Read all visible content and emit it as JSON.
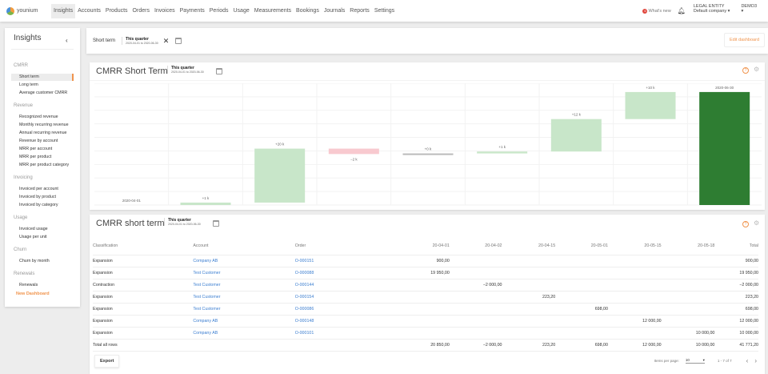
{
  "nav": {
    "logo": "younium",
    "items": [
      "Insights",
      "Accounts",
      "Products",
      "Orders",
      "Invoices",
      "Payments",
      "Periods",
      "Usage",
      "Measurements",
      "Bookings",
      "Journals",
      "Reports",
      "Settings"
    ],
    "active": "Insights",
    "whats_new_count": "6",
    "whats_new": "What's new",
    "legal_entity_label": "LEGAL ENTITY",
    "legal_entity": "Default company",
    "user": "DEMO3"
  },
  "sidebar": {
    "title": "Insights",
    "groups": [
      {
        "label": "CMRR",
        "items": [
          "Short term",
          "Long term",
          "Average customer CMRR"
        ]
      },
      {
        "label": "Revenue",
        "items": [
          "Recognized revenue",
          "Monthly recurring revenue",
          "Annual recurring revenue",
          "Revenue by account",
          "MRR per account",
          "MRR per product",
          "MRR per product category"
        ]
      },
      {
        "label": "Invoicing",
        "items": [
          "Invoiced per account",
          "Invoiced by product",
          "Invoiced by category"
        ]
      },
      {
        "label": "Usage",
        "items": [
          "Invoiced usage",
          "Usage per unit"
        ]
      },
      {
        "label": "Churn",
        "items": [
          "Churn by month"
        ]
      },
      {
        "label": "Renewals",
        "items": [
          "Renewals"
        ]
      }
    ],
    "active": "Short term",
    "new_dashboard": "New Dashboard"
  },
  "filter": {
    "label": "Short term",
    "period": "This quarter",
    "range": "2020-04-01 to 2020-06-30",
    "edit": "Edit dashboard"
  },
  "chart_card": {
    "title": "CMRR Short Term",
    "period": "This quarter",
    "range": "2020-04-01 to 2020-06-30"
  },
  "chart_data": {
    "type": "waterfall",
    "ylim": [
      0,
      45000
    ],
    "grid": true,
    "bars": [
      {
        "label": "2020-04-01",
        "kind": "start",
        "value": 0
      },
      {
        "label": "+1 k",
        "kind": "increase",
        "value": 900
      },
      {
        "label": "+20 k",
        "kind": "increase",
        "value": 19950
      },
      {
        "label": "−2 k",
        "kind": "decrease",
        "value": -2000
      },
      {
        "label": "+0 k",
        "kind": "increase",
        "value": 223.2
      },
      {
        "label": "+1 k",
        "kind": "increase",
        "value": 698
      },
      {
        "label": "+12 k",
        "kind": "increase",
        "value": 12000
      },
      {
        "label": "+10 k",
        "kind": "increase",
        "value": 10000
      },
      {
        "label": "2020-06-30",
        "kind": "end",
        "value": 41771.2
      }
    ],
    "colors": {
      "increase": "#c8e6c9",
      "decrease": "#f8c9cf",
      "end": "#2e7d32"
    }
  },
  "table_card": {
    "title": "CMRR short term",
    "period": "This quarter",
    "range": "2020-04-01 to 2020-06-30",
    "columns": [
      "Classification",
      "Account",
      "Order",
      "20-04-01",
      "20-04-02",
      "20-04-15",
      "20-05-01",
      "20-05-15",
      "20-05-18",
      "Total"
    ],
    "rows": [
      [
        "Expansion",
        "Company AB",
        "O-000151",
        "900,00",
        "",
        "",
        "",
        "",
        "",
        "900,00"
      ],
      [
        "Expansion",
        "Test Customer",
        "O-000088",
        "19 950,00",
        "",
        "",
        "",
        "",
        "",
        "19 950,00"
      ],
      [
        "Contraction",
        "Test Customer",
        "O-000144",
        "",
        "−2 000,00",
        "",
        "",
        "",
        "",
        "−2 000,00"
      ],
      [
        "Expansion",
        "Test Customer",
        "O-000154",
        "",
        "",
        "223,20",
        "",
        "",
        "",
        "223,20"
      ],
      [
        "Expansion",
        "Test Customer",
        "O-000086",
        "",
        "",
        "",
        "698,00",
        "",
        "",
        "698,00"
      ],
      [
        "Expansion",
        "Company AB",
        "O-000148",
        "",
        "",
        "",
        "",
        "12 000,00",
        "",
        "12 000,00"
      ],
      [
        "Expansion",
        "Company AB",
        "O-000101",
        "",
        "",
        "",
        "",
        "",
        "10 000,00",
        "10 000,00"
      ]
    ],
    "total": [
      "Total all rows",
      "",
      "",
      "20 850,00",
      "−2 000,00",
      "223,20",
      "698,00",
      "12 000,00",
      "10 000,00",
      "41 771,20"
    ],
    "export": "Export",
    "items_per_page_label": "Items per page:",
    "items_per_page": "10",
    "range_label": "1 - 7 of 7"
  }
}
